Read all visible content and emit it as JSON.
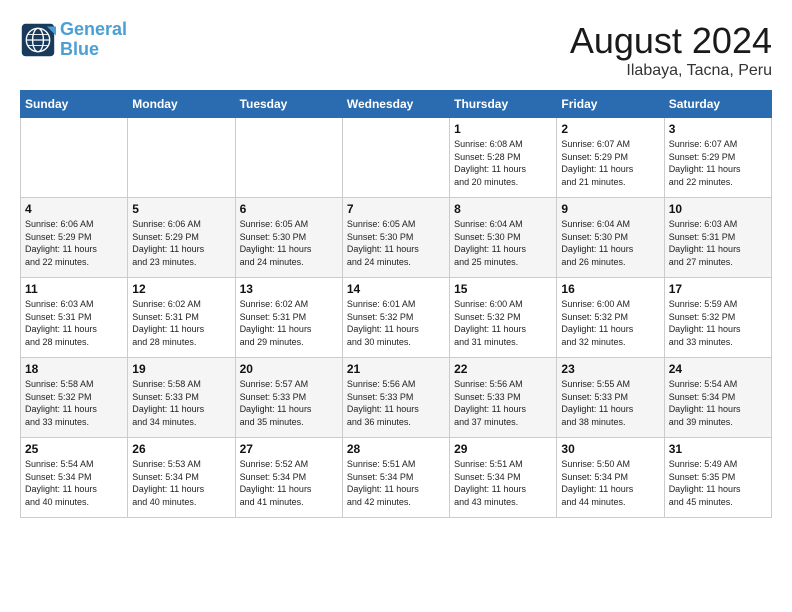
{
  "header": {
    "logo_line1": "General",
    "logo_line2": "Blue",
    "month": "August 2024",
    "location": "Ilabaya, Tacna, Peru"
  },
  "weekdays": [
    "Sunday",
    "Monday",
    "Tuesday",
    "Wednesday",
    "Thursday",
    "Friday",
    "Saturday"
  ],
  "weeks": [
    [
      {
        "day": "",
        "info": ""
      },
      {
        "day": "",
        "info": ""
      },
      {
        "day": "",
        "info": ""
      },
      {
        "day": "",
        "info": ""
      },
      {
        "day": "1",
        "info": "Sunrise: 6:08 AM\nSunset: 5:28 PM\nDaylight: 11 hours\nand 20 minutes."
      },
      {
        "day": "2",
        "info": "Sunrise: 6:07 AM\nSunset: 5:29 PM\nDaylight: 11 hours\nand 21 minutes."
      },
      {
        "day": "3",
        "info": "Sunrise: 6:07 AM\nSunset: 5:29 PM\nDaylight: 11 hours\nand 22 minutes."
      }
    ],
    [
      {
        "day": "4",
        "info": "Sunrise: 6:06 AM\nSunset: 5:29 PM\nDaylight: 11 hours\nand 22 minutes."
      },
      {
        "day": "5",
        "info": "Sunrise: 6:06 AM\nSunset: 5:29 PM\nDaylight: 11 hours\nand 23 minutes."
      },
      {
        "day": "6",
        "info": "Sunrise: 6:05 AM\nSunset: 5:30 PM\nDaylight: 11 hours\nand 24 minutes."
      },
      {
        "day": "7",
        "info": "Sunrise: 6:05 AM\nSunset: 5:30 PM\nDaylight: 11 hours\nand 24 minutes."
      },
      {
        "day": "8",
        "info": "Sunrise: 6:04 AM\nSunset: 5:30 PM\nDaylight: 11 hours\nand 25 minutes."
      },
      {
        "day": "9",
        "info": "Sunrise: 6:04 AM\nSunset: 5:30 PM\nDaylight: 11 hours\nand 26 minutes."
      },
      {
        "day": "10",
        "info": "Sunrise: 6:03 AM\nSunset: 5:31 PM\nDaylight: 11 hours\nand 27 minutes."
      }
    ],
    [
      {
        "day": "11",
        "info": "Sunrise: 6:03 AM\nSunset: 5:31 PM\nDaylight: 11 hours\nand 28 minutes."
      },
      {
        "day": "12",
        "info": "Sunrise: 6:02 AM\nSunset: 5:31 PM\nDaylight: 11 hours\nand 28 minutes."
      },
      {
        "day": "13",
        "info": "Sunrise: 6:02 AM\nSunset: 5:31 PM\nDaylight: 11 hours\nand 29 minutes."
      },
      {
        "day": "14",
        "info": "Sunrise: 6:01 AM\nSunset: 5:32 PM\nDaylight: 11 hours\nand 30 minutes."
      },
      {
        "day": "15",
        "info": "Sunrise: 6:00 AM\nSunset: 5:32 PM\nDaylight: 11 hours\nand 31 minutes."
      },
      {
        "day": "16",
        "info": "Sunrise: 6:00 AM\nSunset: 5:32 PM\nDaylight: 11 hours\nand 32 minutes."
      },
      {
        "day": "17",
        "info": "Sunrise: 5:59 AM\nSunset: 5:32 PM\nDaylight: 11 hours\nand 33 minutes."
      }
    ],
    [
      {
        "day": "18",
        "info": "Sunrise: 5:58 AM\nSunset: 5:32 PM\nDaylight: 11 hours\nand 33 minutes."
      },
      {
        "day": "19",
        "info": "Sunrise: 5:58 AM\nSunset: 5:33 PM\nDaylight: 11 hours\nand 34 minutes."
      },
      {
        "day": "20",
        "info": "Sunrise: 5:57 AM\nSunset: 5:33 PM\nDaylight: 11 hours\nand 35 minutes."
      },
      {
        "day": "21",
        "info": "Sunrise: 5:56 AM\nSunset: 5:33 PM\nDaylight: 11 hours\nand 36 minutes."
      },
      {
        "day": "22",
        "info": "Sunrise: 5:56 AM\nSunset: 5:33 PM\nDaylight: 11 hours\nand 37 minutes."
      },
      {
        "day": "23",
        "info": "Sunrise: 5:55 AM\nSunset: 5:33 PM\nDaylight: 11 hours\nand 38 minutes."
      },
      {
        "day": "24",
        "info": "Sunrise: 5:54 AM\nSunset: 5:34 PM\nDaylight: 11 hours\nand 39 minutes."
      }
    ],
    [
      {
        "day": "25",
        "info": "Sunrise: 5:54 AM\nSunset: 5:34 PM\nDaylight: 11 hours\nand 40 minutes."
      },
      {
        "day": "26",
        "info": "Sunrise: 5:53 AM\nSunset: 5:34 PM\nDaylight: 11 hours\nand 40 minutes."
      },
      {
        "day": "27",
        "info": "Sunrise: 5:52 AM\nSunset: 5:34 PM\nDaylight: 11 hours\nand 41 minutes."
      },
      {
        "day": "28",
        "info": "Sunrise: 5:51 AM\nSunset: 5:34 PM\nDaylight: 11 hours\nand 42 minutes."
      },
      {
        "day": "29",
        "info": "Sunrise: 5:51 AM\nSunset: 5:34 PM\nDaylight: 11 hours\nand 43 minutes."
      },
      {
        "day": "30",
        "info": "Sunrise: 5:50 AM\nSunset: 5:34 PM\nDaylight: 11 hours\nand 44 minutes."
      },
      {
        "day": "31",
        "info": "Sunrise: 5:49 AM\nSunset: 5:35 PM\nDaylight: 11 hours\nand 45 minutes."
      }
    ]
  ]
}
